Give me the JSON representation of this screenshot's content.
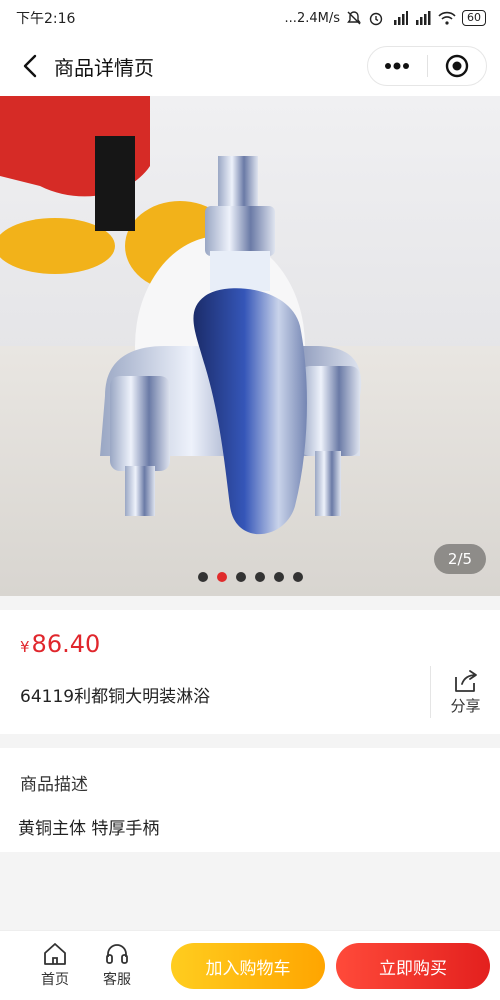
{
  "status_bar": {
    "time": "下午2:16",
    "network_speed": "...2.4M/s",
    "battery": "60",
    "icons": [
      "mute-icon",
      "alarm-icon",
      "hd-signal-icon",
      "signal-icon",
      "wifi-icon",
      "battery-icon"
    ]
  },
  "nav": {
    "title": "商品详情页",
    "icons": {
      "back": "chevron-left-icon",
      "more": "more-dots-icon",
      "close": "target-circle-icon"
    }
  },
  "gallery": {
    "counter": "2/5",
    "total": 6,
    "active_index": 1,
    "image": "faucet-product-photo"
  },
  "product": {
    "currency": "¥",
    "price": "86.40",
    "name": "64119利都铜大明装淋浴",
    "share_label": "分享"
  },
  "description": {
    "title": "商品描述",
    "text": "黄铜主体 特厚手柄"
  },
  "bottom_bar": {
    "home_label": "首页",
    "service_label": "客服",
    "add_to_cart": "加入购物车",
    "buy_now": "立即购买"
  },
  "colors": {
    "price": "#e0262c",
    "cart_button": "#ffb20f",
    "buy_button": "#f0302a",
    "dot_active": "#e02b2b"
  }
}
